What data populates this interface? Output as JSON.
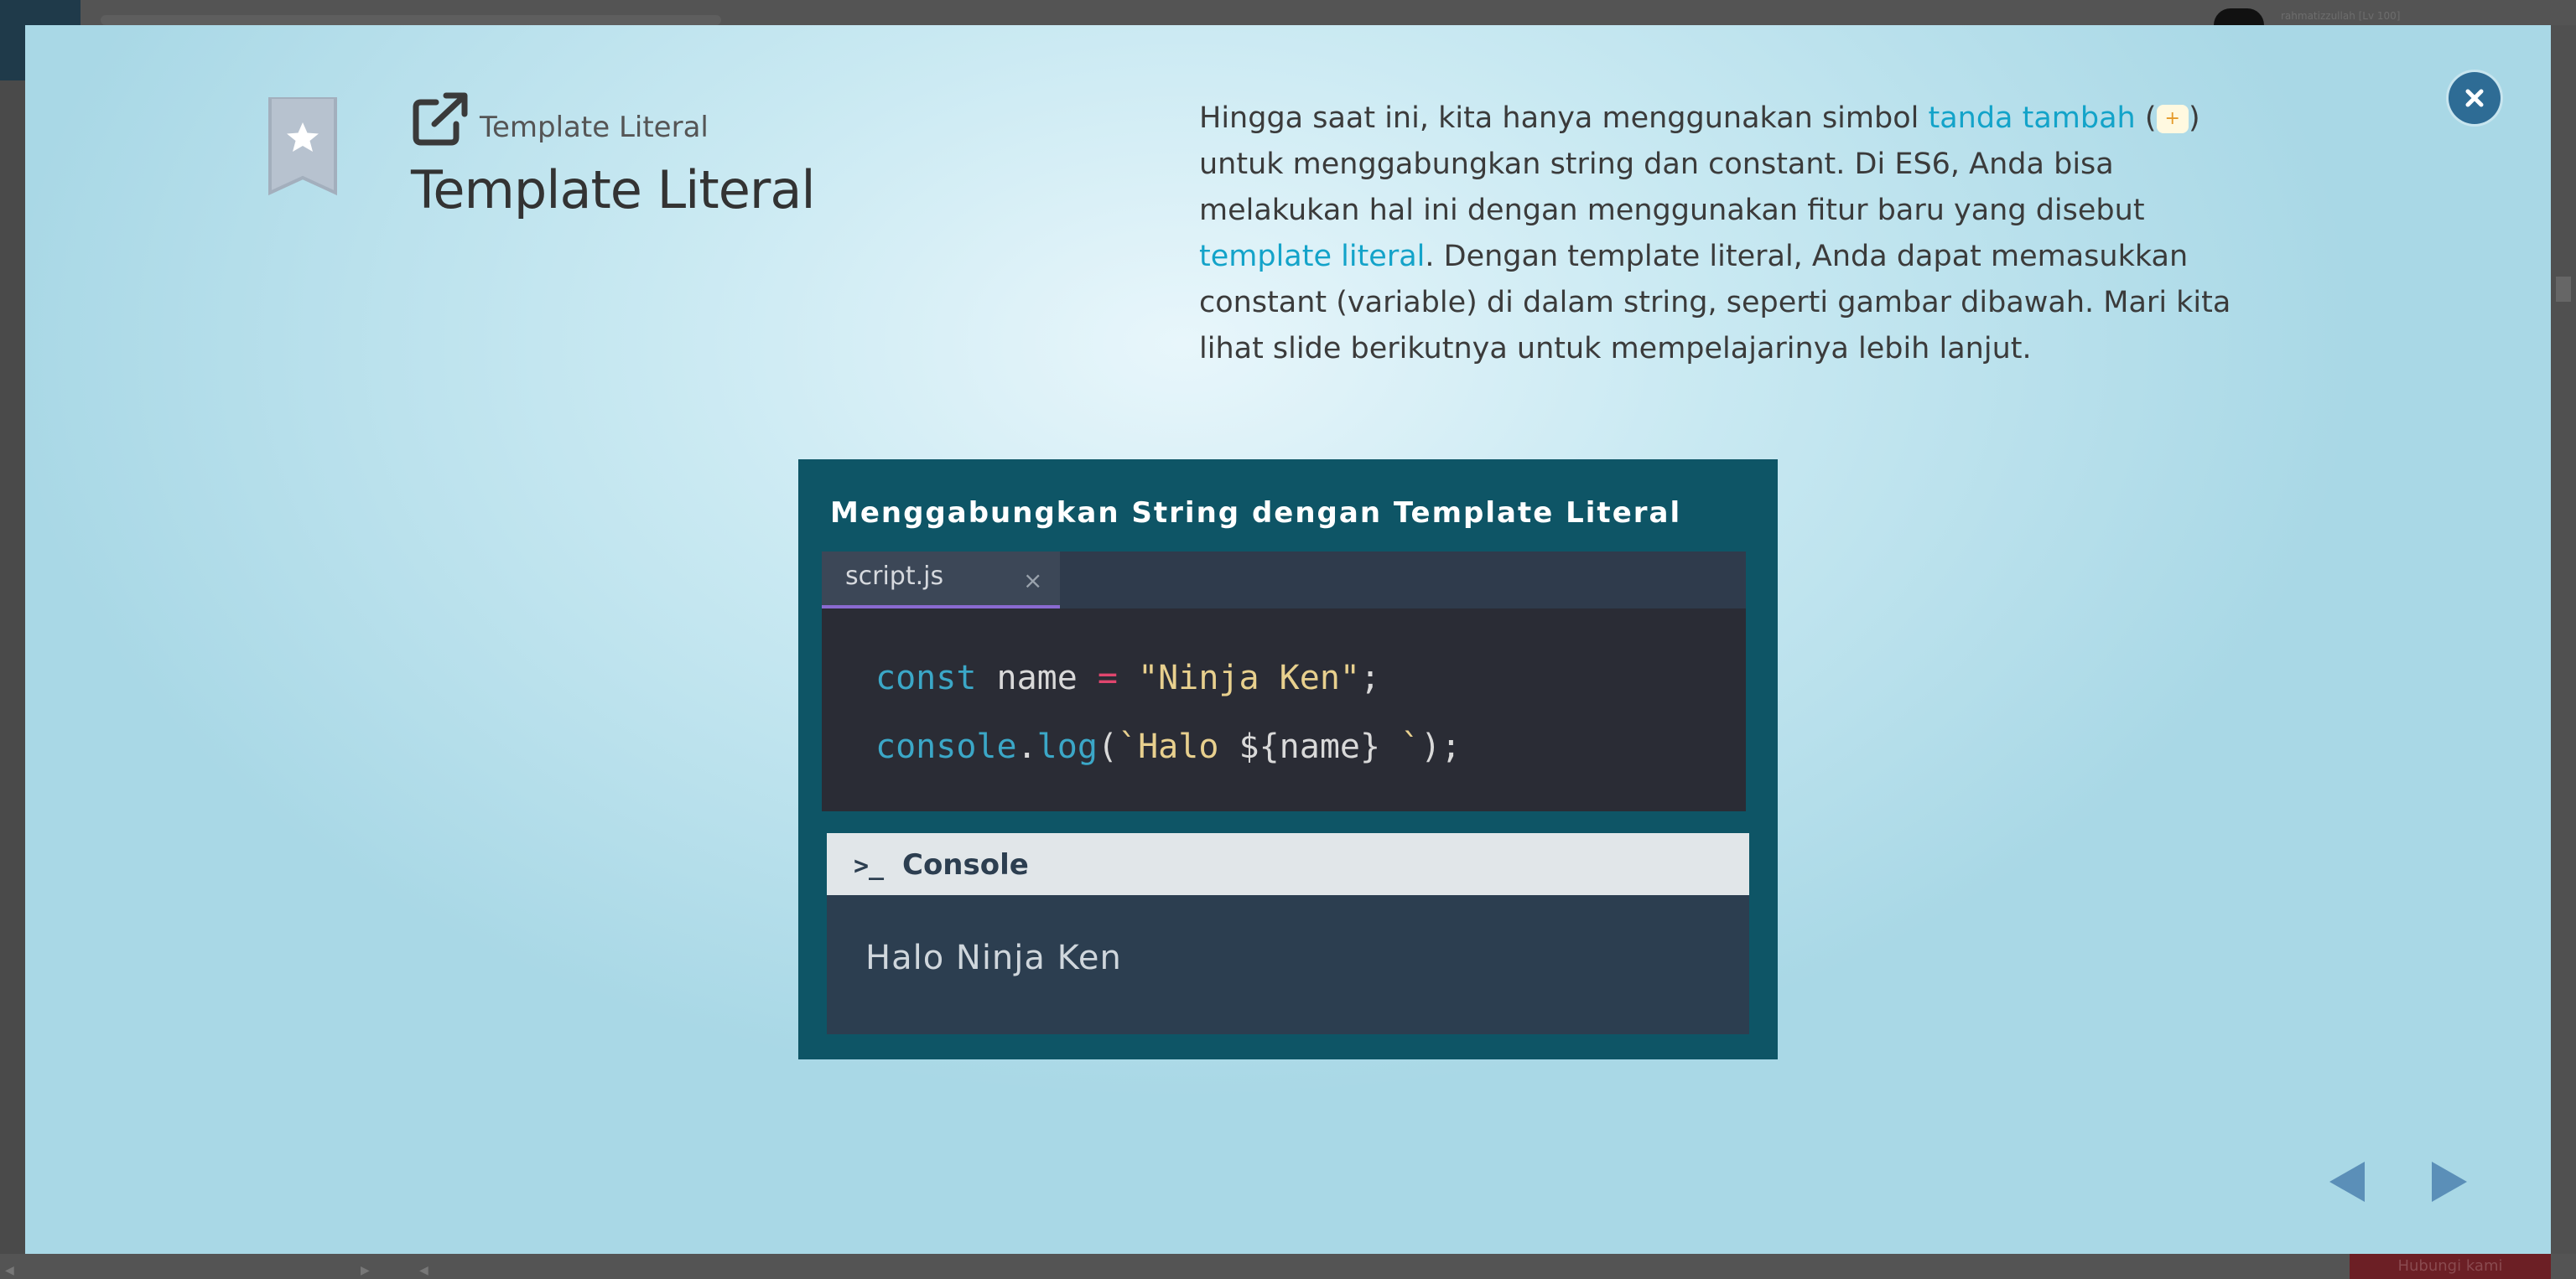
{
  "backdrop": {
    "user_label": "rahmatizzullah [Lv 100]",
    "bottom_button": "Hubungi kami"
  },
  "header": {
    "lesson_subtitle": "Template Literal",
    "lesson_title": "Template Literal"
  },
  "description": {
    "part1": "Hingga saat ini, kita hanya menggunakan simbol ",
    "link1": "tanda tambah",
    "part2": " (",
    "chip": "+",
    "part3": ") untuk menggabungkan string dan constant. Di ES6, Anda bisa melakukan hal ini dengan menggunakan fitur baru yang disebut ",
    "link2": "template literal",
    "part4": ". Dengan template literal, Anda dapat memasukkan constant (variable) di dalam string, seperti gambar dibawah. Mari kita lihat slide berikutnya untuk mempelajarinya lebih lanjut."
  },
  "slide": {
    "title": "Menggabungkan String dengan Template Literal",
    "tab_label": "script.js",
    "tab_close": "×",
    "code": {
      "line1": {
        "kw": "const",
        "name": " name ",
        "op": "=",
        "str": " \"Ninja Ken\"",
        "end": ";"
      },
      "line2": {
        "obj": "console",
        "dot": ".",
        "fn": "log",
        "open": "(",
        "str": "`Halo ",
        "interp": "${name}",
        "str_end": " `",
        "end": ");"
      }
    },
    "console_icon": ">_",
    "console_label": "Console",
    "console_output": "Halo Ninja Ken"
  },
  "colors": {
    "accent": "#13a3c9",
    "close_button": "#2e6c95",
    "nav_arrows": "#5b8fb8"
  },
  "icons": {
    "close": "close-icon",
    "bookmark": "bookmark-star-icon",
    "external": "external-link-icon",
    "prev": "arrow-left-icon",
    "next": "arrow-right-icon"
  }
}
